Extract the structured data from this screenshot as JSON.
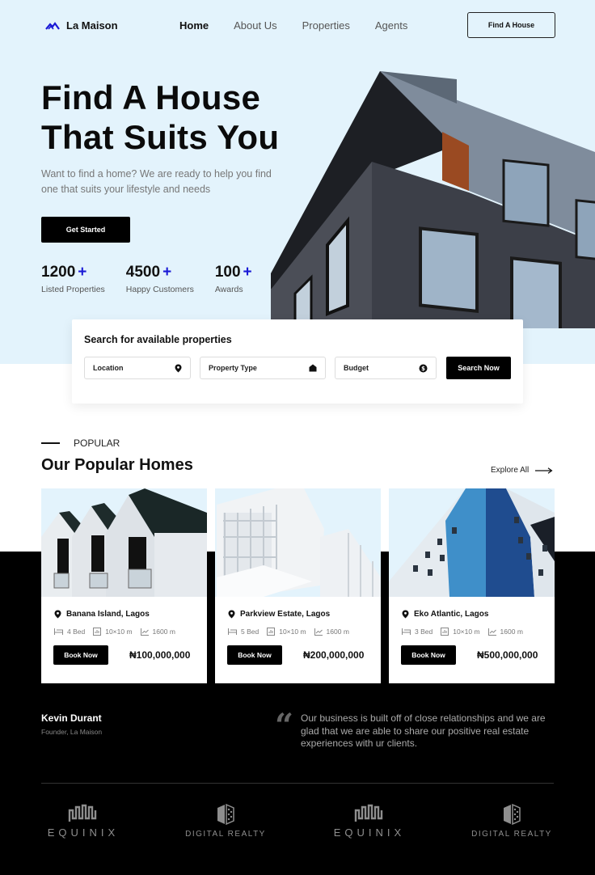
{
  "colors": {
    "hero_bg": "#e3f3fc",
    "accent": "#1a1ad6",
    "dark": "#000000"
  },
  "header": {
    "brand": "La Maison",
    "nav": [
      {
        "label": "Home",
        "active": true
      },
      {
        "label": "About Us",
        "active": false
      },
      {
        "label": "Properties",
        "active": false
      },
      {
        "label": "Agents",
        "active": false
      }
    ],
    "cta_label": "Find A House"
  },
  "hero": {
    "title_line1": "Find A House",
    "title_line2": "That Suits You",
    "subtitle": "Want to find a home? We are ready to help you find one that suits your lifestyle and needs",
    "cta_label": "Get Started",
    "stats": [
      {
        "value": "1200",
        "suffix": "+",
        "label": "Listed Properties"
      },
      {
        "value": "4500",
        "suffix": "+",
        "label": "Happy Customers"
      },
      {
        "value": "100",
        "suffix": "+",
        "label": "Awards"
      }
    ]
  },
  "search": {
    "title": "Search for available properties",
    "fields": [
      {
        "label": "Location",
        "icon": "map-pin-icon"
      },
      {
        "label": "Property Type",
        "icon": "house-icon"
      },
      {
        "label": "Budget",
        "icon": "dollar-circle-icon"
      }
    ],
    "button_label": "Search Now"
  },
  "popular": {
    "eyebrow": "POPULAR",
    "title": "Our Popular Homes",
    "explore_label": "Explore All",
    "homes": [
      {
        "location": "Banana Island, Lagos",
        "beds": "4 Bed",
        "size": "10×10 m",
        "area": "1600 m",
        "book_label": "Book Now",
        "price": "₦100,000,000"
      },
      {
        "location": "Parkview Estate, Lagos",
        "beds": "5 Bed",
        "size": "10×10 m",
        "area": "1600 m",
        "book_label": "Book Now",
        "price": "₦200,000,000"
      },
      {
        "location": "Eko Atlantic, Lagos",
        "beds": "3 Bed",
        "size": "10×10 m",
        "area": "1600 m",
        "book_label": "Book Now",
        "price": "₦500,000,000"
      }
    ]
  },
  "testimonial": {
    "name": "Kevin Durant",
    "role": "Founder, La Maison",
    "quote_mark": "“",
    "quote": "Our business is built off of close relationships and we are glad that we are able to share our positive real estate experiences with ur clients."
  },
  "partners": [
    {
      "name": "EQUINIX"
    },
    {
      "name": "DIGITAL REALTY"
    },
    {
      "name": "EQUINIX"
    },
    {
      "name": "DIGITAL REALTY"
    }
  ]
}
